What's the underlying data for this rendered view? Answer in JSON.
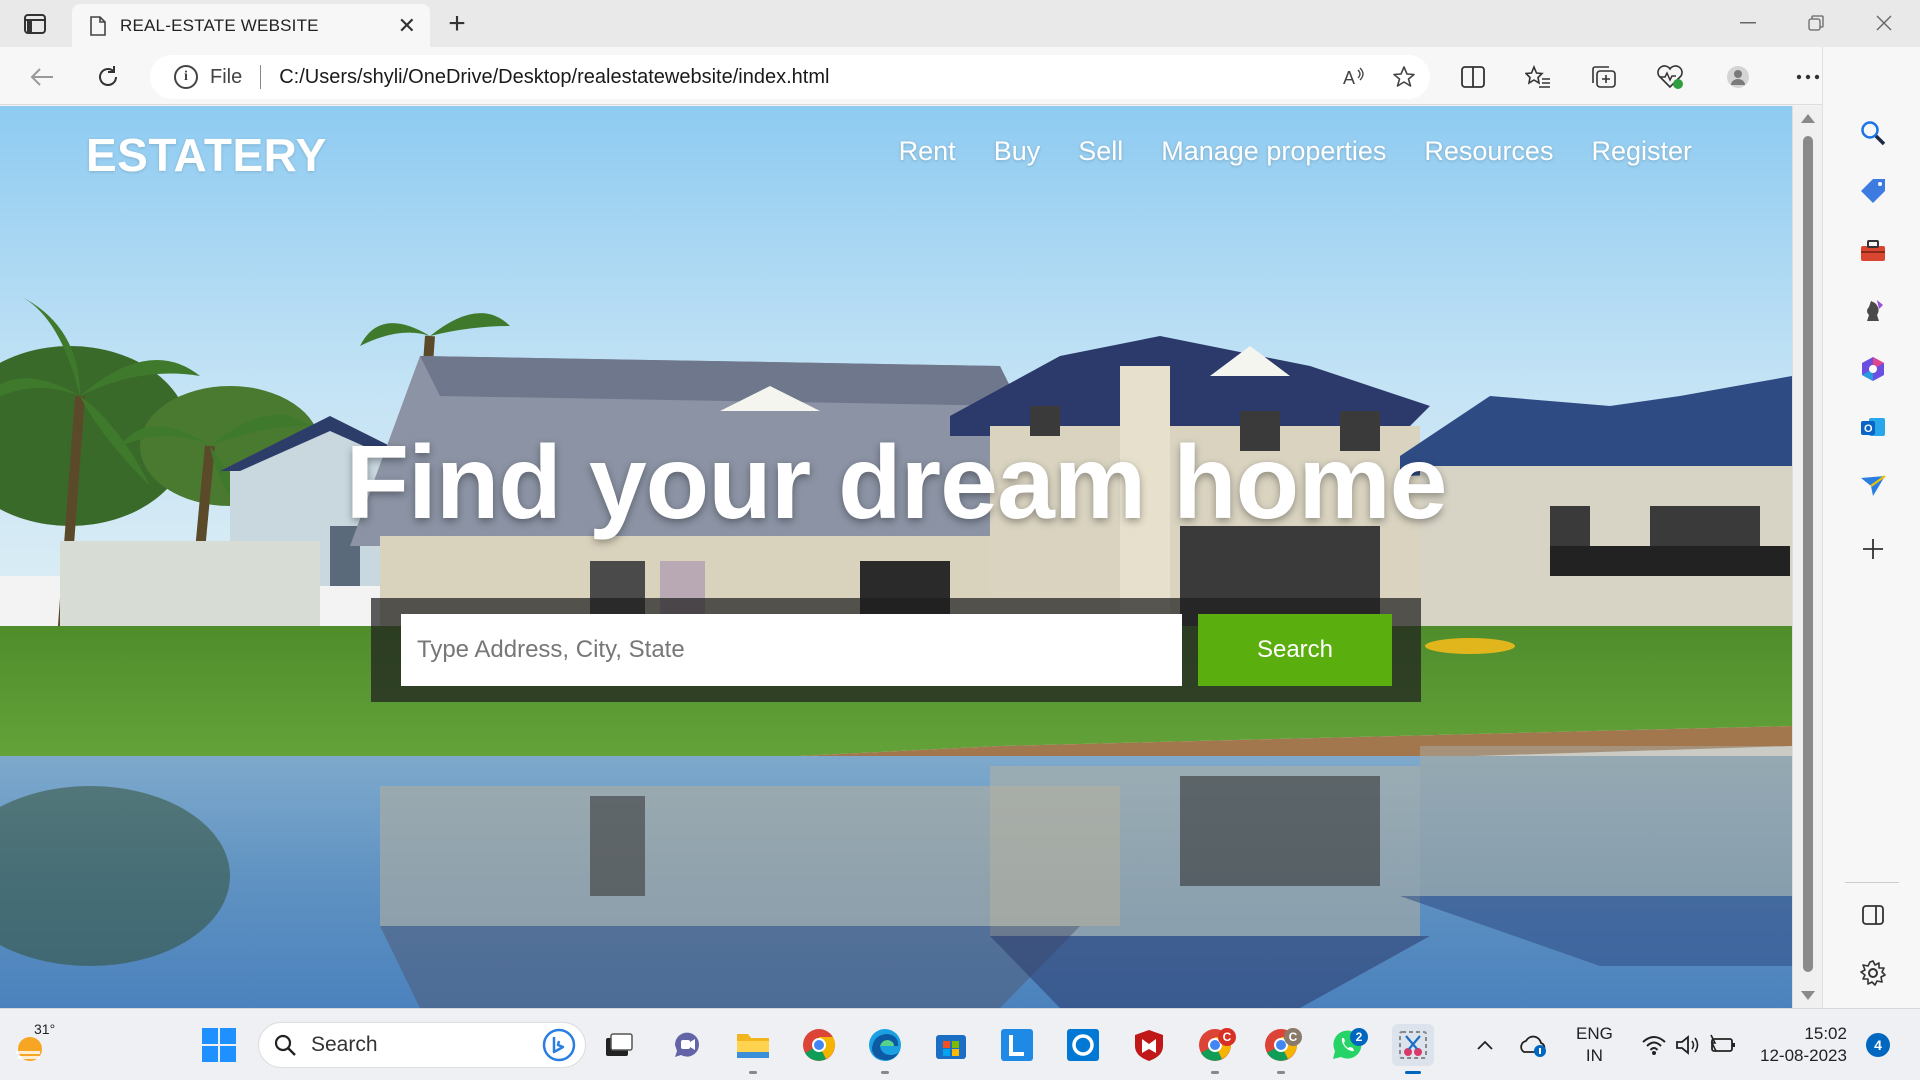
{
  "browser": {
    "tab_title": "REAL-ESTATE WEBSITE",
    "address_file_label": "File",
    "url": "C:/Users/shyli/OneDrive/Desktop/realestatewebsite/index.html"
  },
  "site": {
    "logo": "ESTATERY",
    "nav": [
      "Rent",
      "Buy",
      "Sell",
      "Manage properties",
      "Resources",
      "Register"
    ],
    "headline": "Find your dream home",
    "search_placeholder": "Type Address, City, State",
    "search_button": "Search",
    "colors": {
      "search_button": "#5aae0d",
      "sky_top": "#9fd3f3",
      "water": "#5a8ec0"
    }
  },
  "taskbar": {
    "weather_temp": "31°",
    "search_label": "Search",
    "badges": {
      "chrome1": "C",
      "chrome2": "C",
      "whatsapp": "2"
    },
    "lang_line1": "ENG",
    "lang_line2": "IN",
    "time": "15:02",
    "date": "12-08-2023",
    "notifications": "4"
  }
}
